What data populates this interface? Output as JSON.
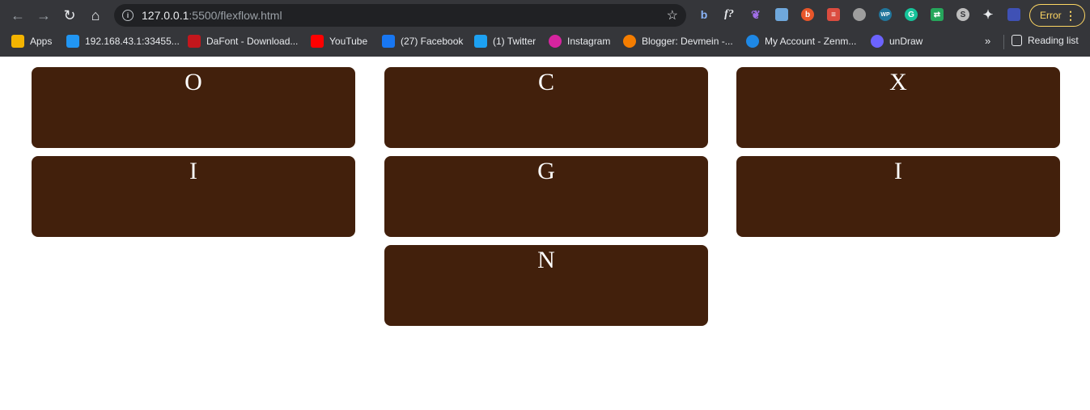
{
  "browser": {
    "url_host": "127.0.0.1",
    "url_rest": ":5500/flexflow.html",
    "error_label": "Error",
    "bookmarks": [
      {
        "label": "Apps",
        "color": "#f4b400"
      },
      {
        "label": "192.168.43.1:33455...",
        "color": "#2196f3"
      },
      {
        "label": "DaFont - Download...",
        "color": "#c4161c"
      },
      {
        "label": "YouTube",
        "color": "#ff0000"
      },
      {
        "label": "(27) Facebook",
        "color": "#1877f2"
      },
      {
        "label": "(1) Twitter",
        "color": "#1da1f2"
      },
      {
        "label": "Instagram",
        "color": "#d6249f"
      },
      {
        "label": "Blogger: Devmein -...",
        "color": "#f57d00"
      },
      {
        "label": "My Account - Zenm...",
        "color": "#1e88e5"
      },
      {
        "label": "unDraw",
        "color": "#6c63ff"
      }
    ],
    "overflow_label": "»",
    "reading_list_label": "Reading list"
  },
  "page": {
    "box_color": "#42200c",
    "boxes": [
      "O",
      "C",
      "X",
      "I",
      "G",
      "I",
      "N"
    ]
  }
}
